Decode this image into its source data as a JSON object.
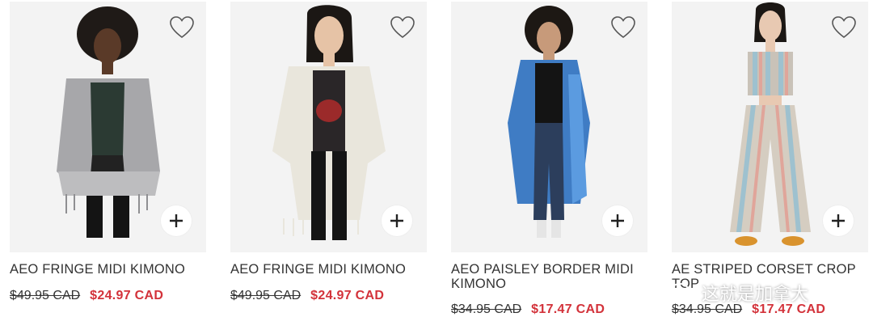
{
  "products": [
    {
      "name": "AEO FRINGE MIDI KIMONO",
      "old_price": "$49.95 CAD",
      "sale_price": "$24.97 CAD"
    },
    {
      "name": "AEO FRINGE MIDI KIMONO",
      "old_price": "$49.95 CAD",
      "sale_price": "$24.97 CAD"
    },
    {
      "name": "AEO PAISLEY BORDER MIDI KIMONO",
      "old_price": "$34.95 CAD",
      "sale_price": "$17.47 CAD"
    },
    {
      "name": "AE STRIPED CORSET CROP TOP",
      "old_price": "$34.95 CAD",
      "sale_price": "$17.47 CAD"
    }
  ],
  "watermark": {
    "text": "这就是加拿大"
  },
  "icons": {
    "favorite": "heart-icon",
    "add": "plus-icon"
  },
  "colors": {
    "sale": "#d3323a",
    "text": "#333333",
    "photo_bg": "#f3f3f3"
  }
}
